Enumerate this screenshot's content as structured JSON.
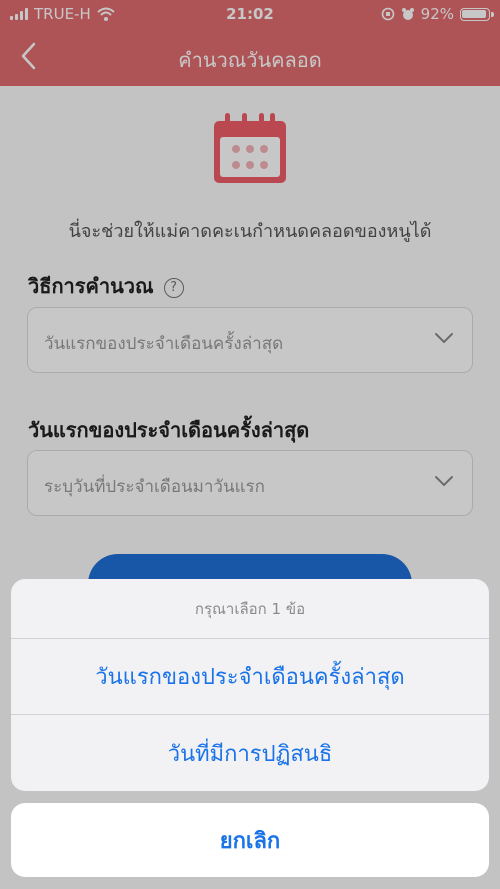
{
  "status": {
    "carrier": "TRUE-H",
    "time": "21:02",
    "battery": "92%"
  },
  "nav": {
    "title": "คำนวณวันคลอด"
  },
  "intro": "นี่จะช่วยให้แม่คาดคะเนกำหนดคลอดของหนูได้",
  "method": {
    "label": "วิธีการคำนวณ",
    "help": "?",
    "value": "วันแรกของประจำเดือนครั้งล่าสุด"
  },
  "lmp": {
    "label": "วันแรกของประจำเดือนครั้งล่าสุด",
    "placeholder": "ระบุวันที่ประจำเดือนมาวันแรก"
  },
  "sheet": {
    "title": "กรุณาเลือก 1 ข้อ",
    "options": [
      "วันแรกของประจำเดือนครั้งล่าสุด",
      "วันที่มีการปฏิสนธิ"
    ],
    "cancel": "ยกเลิก"
  },
  "colors": {
    "header": "#e06c6f",
    "accent": "#1a73e8",
    "button": "#1f6fd6"
  }
}
